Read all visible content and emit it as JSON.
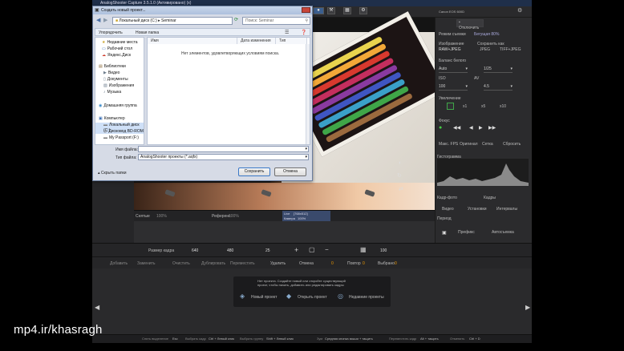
{
  "app": {
    "title": "AnalogShooter Capture 3.5.1.0 (Активировано) (x)",
    "camera_label": "Canon EOS 600D",
    "disconnect_label": "Отключить"
  },
  "right_panel": {
    "tabs": [
      "Режим съемки",
      "Бегущая 80%"
    ],
    "image_label": "Изображение",
    "image_value": "RAW+JPEG",
    "save_label": "Сохранить как",
    "save_options": [
      "JPEG",
      "TIFF+JPEG"
    ],
    "wb_label": "Баланс белого",
    "wb_value": "Auto",
    "exposure_value": "1/25",
    "iso_label": "ISO",
    "iso_value": "100",
    "av_label": "AV",
    "av_value": "4.5",
    "zoom_label": "Увеличение",
    "zoom_options": [
      "x1",
      "x5",
      "x10"
    ],
    "focus_label": "Фокус",
    "display_label": "Макс. FPS",
    "display_options": [
      "Оригинал",
      "Сетка",
      "Сбросить"
    ],
    "histogram_label": "Гистограмма",
    "shoot_tabs": [
      "Кадр-фото",
      "Кадры"
    ],
    "shoot_options": [
      "Видео",
      "Установки",
      "Интервалы"
    ],
    "period_label": "Период",
    "prefix_label": "Префикс",
    "autosave_label": "Автосъемка",
    "add_label": "Добавить",
    "delete_label": "Удалить"
  },
  "viewer": {
    "onion_label": "Снятые",
    "onion_value": "100%",
    "ref_label": "Референс",
    "ref_value": "100%",
    "live_label": "Live",
    "live_value": "[768x512]",
    "cam_label": "Камера",
    "cam_value": "100%"
  },
  "nav": {
    "frame_size_label": "Размер кадра",
    "width": "640",
    "height": "480",
    "fps": "25",
    "zoom": "100"
  },
  "actions": [
    "Добавить",
    "Заменить",
    "Очистить",
    "Дублировать",
    "Переместить",
    "Удалить",
    "Отмена",
    "Повтор",
    "Выбрано"
  ],
  "actions_counts": [
    "0",
    "0",
    "0"
  ],
  "notice": {
    "text_line1": "Нет проекта. Создайте новый или откройте существующий",
    "text_line2": "проект, чтобы начать, добавить или редактировать кадры",
    "buttons": [
      "Новый проект",
      "Открыть проект",
      "Недавние проекты"
    ]
  },
  "status": {
    "items": [
      "Снять выделение",
      "Esc",
      "Выбрать кадр",
      "Ctrl + Левый клик",
      "Выбрать группу",
      "Shift + Левый клик",
      "Зум",
      "Средняя кнопка мыши + тащить",
      "Переместить кадр",
      "Alt + тащить",
      "Отменить",
      "Ctrl + D"
    ]
  },
  "dialog": {
    "title": "Создать новый проект...",
    "path": [
      "Локальный диск (C:)",
      "Seminar"
    ],
    "search_placeholder": "Поиск: Seminar",
    "organize_label": "Упорядочить",
    "new_folder_label": "Новая папка",
    "columns": [
      "Имя",
      "Дата изменения",
      "Тип"
    ],
    "empty_message": "Нет элементов, удовлетворяющих условиям поиска.",
    "tree": [
      {
        "label": "Недавние места",
        "icon": "star-icon"
      },
      {
        "label": "Рабочий стол",
        "icon": "desktop-icon"
      },
      {
        "label": "Яндекс.Диск",
        "icon": "cloud-icon"
      },
      {
        "label": "Библиотеки",
        "icon": "library-icon"
      },
      {
        "label": "Видео",
        "icon": "video-icon"
      },
      {
        "label": "Документы",
        "icon": "document-icon"
      },
      {
        "label": "Изображения",
        "icon": "image-icon"
      },
      {
        "label": "Музыка",
        "icon": "music-icon"
      },
      {
        "label": "Домашняя группа",
        "icon": "homegroup-icon"
      },
      {
        "label": "Компьютер",
        "icon": "computer-icon"
      },
      {
        "label": "Локальный диск (C:)",
        "icon": "drive-icon"
      },
      {
        "label": "Дисковод BD-ROM",
        "icon": "disc-icon"
      },
      {
        "label": "My Passport (F:)",
        "icon": "drive-icon"
      }
    ],
    "filename_label": "Имя файла:",
    "filename_value": "",
    "filetype_label": "Тип файла:",
    "filetype_value": "AnalogShooter проекты (*.aqfx)",
    "hide_folders_label": "Скрыть папки",
    "save_label": "Сохранить",
    "cancel_label": "Отмена"
  },
  "watermark": "mp4.ir/khasragh"
}
